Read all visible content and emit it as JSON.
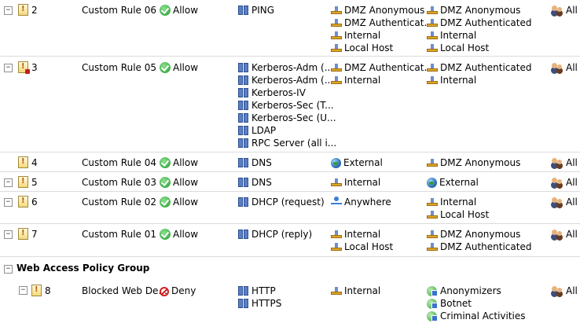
{
  "rules": [
    {
      "order": "2",
      "name": "Custom Rule 06",
      "action": "Allow",
      "protocols": [
        "PING"
      ],
      "from": [
        "DMZ Anonymous",
        "DMZ Authenticat...",
        "Internal",
        "Local Host"
      ],
      "to": [
        "DMZ Anonymous",
        "DMZ Authenticated",
        "Internal",
        "Local Host"
      ],
      "condition": "All"
    },
    {
      "order": "3",
      "name": "Custom Rule 05",
      "action": "Allow",
      "protocols": [
        "Kerberos-Adm (...",
        "Kerberos-Adm (...",
        "Kerberos-IV",
        "Kerberos-Sec (T...",
        "Kerberos-Sec (U...",
        "LDAP",
        "RPC Server (all i..."
      ],
      "from": [
        "DMZ Authenticat...",
        "Internal"
      ],
      "to": [
        "DMZ Authenticated",
        "Internal"
      ],
      "condition": "All"
    },
    {
      "order": "4",
      "name": "Custom Rule 04",
      "action": "Allow",
      "protocols": [
        "DNS"
      ],
      "from": [
        "External"
      ],
      "to": [
        "DMZ Anonymous"
      ],
      "condition": "All"
    },
    {
      "order": "5",
      "name": "Custom Rule 03",
      "action": "Allow",
      "protocols": [
        "DNS"
      ],
      "from": [
        "Internal"
      ],
      "to": [
        "External"
      ],
      "condition": "All"
    },
    {
      "order": "6",
      "name": "Custom Rule 02",
      "action": "Allow",
      "protocols": [
        "DHCP (request)"
      ],
      "from": [
        "Anywhere"
      ],
      "to": [
        "Internal",
        "Local Host"
      ],
      "condition": "All"
    },
    {
      "order": "7",
      "name": "Custom Rule 01",
      "action": "Allow",
      "protocols": [
        "DHCP (reply)"
      ],
      "from": [
        "Internal",
        "Local Host"
      ],
      "to": [
        "DMZ Anonymous",
        "DMZ Authenticated"
      ],
      "condition": "All"
    }
  ],
  "group": {
    "label": "Web Access Policy Group"
  },
  "group_rule": {
    "order": "8",
    "name": "Blocked Web De...",
    "action": "Deny",
    "protocols": [
      "HTTP",
      "HTTPS"
    ],
    "from": [
      "Internal"
    ],
    "to": [
      "Anonymizers",
      "Botnet",
      "Criminal Activities"
    ],
    "condition": "All"
  }
}
